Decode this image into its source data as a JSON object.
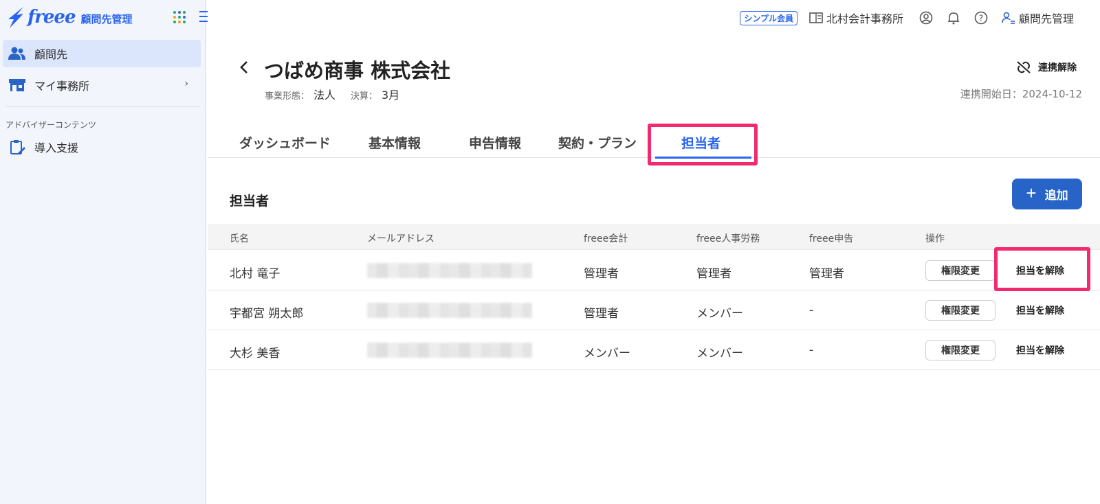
{
  "brand": {
    "logo_word": "freee",
    "logo_sub": "顧問先管理"
  },
  "sidebar": {
    "items": [
      {
        "label": "顧問先"
      },
      {
        "label": "マイ事務所"
      }
    ],
    "section_label": "アドバイザーコンテンツ",
    "section_items": [
      {
        "label": "導入支援"
      }
    ]
  },
  "topbar": {
    "badge": "シンプル会員",
    "office": "北村会計事務所",
    "app_name": "顧問先管理"
  },
  "page": {
    "company_name": "つばめ商事 株式会社",
    "business_type_label": "事業形態：",
    "business_type": "法人",
    "fiscal_label": "決算：",
    "fiscal_month": "3月",
    "unlink_label": "連携解除",
    "since": "連携開始日：2024-10-12"
  },
  "tabs": [
    {
      "label": "ダッシュボード"
    },
    {
      "label": "基本情報"
    },
    {
      "label": "申告情報"
    },
    {
      "label": "契約・プラン"
    },
    {
      "label": "担当者"
    }
  ],
  "section": {
    "title": "担当者",
    "add_label": "追加"
  },
  "table": {
    "headers": [
      "氏名",
      "メールアドレス",
      "freee会計",
      "freee人事労務",
      "freee申告",
      "操作"
    ],
    "rows": [
      {
        "name": "北村 竜子",
        "accounting": "管理者",
        "hr": "管理者",
        "tax": "管理者"
      },
      {
        "name": "宇都宮 朔太郎",
        "accounting": "管理者",
        "hr": "メンバー",
        "tax": "-"
      },
      {
        "name": "大杉 美香",
        "accounting": "メンバー",
        "hr": "メンバー",
        "tax": "-"
      }
    ],
    "perm_label": "権限変更",
    "release_label": "担当を解除"
  },
  "colors": {
    "brand": "#2864f0",
    "highlight": "#f2296f",
    "button": "#2864c8"
  }
}
